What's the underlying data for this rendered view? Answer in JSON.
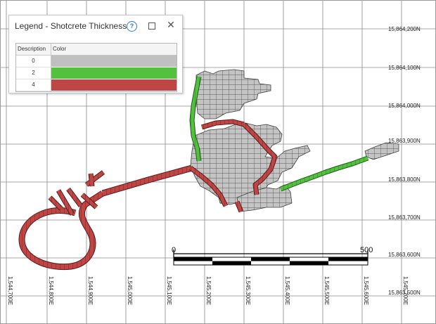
{
  "legend": {
    "title": "Legend - Shotcrete Thickness",
    "columns": {
      "description": "Description",
      "color": "Color"
    },
    "rows": [
      {
        "description": "0",
        "color": "#c0c0c0"
      },
      {
        "description": "2",
        "color": "#52c23e"
      },
      {
        "description": "4",
        "color": "#c04646"
      }
    ]
  },
  "northing_labels": [
    "15,864,200N",
    "15,864,100N",
    "15,864,000N",
    "15,863,900N",
    "15,863,800N",
    "15,863,700N",
    "15,863,600N",
    "15,863,500N"
  ],
  "easting_labels": [
    "1,544,700E",
    "1,544,800E",
    "1,544,900E",
    "1,545,000E",
    "1,545,100E",
    "1,545,200E",
    "1,545,300E",
    "1,545,400E",
    "1,545,500E",
    "1,545,600E",
    "1,545,700E"
  ],
  "scale_bar": {
    "start_label": "0",
    "end_label": "500"
  },
  "colors": {
    "unsupported": "#c0c0c0",
    "thickness_2": "#52c23e",
    "thickness_4": "#c04646",
    "grid": "#8a8a8a"
  }
}
